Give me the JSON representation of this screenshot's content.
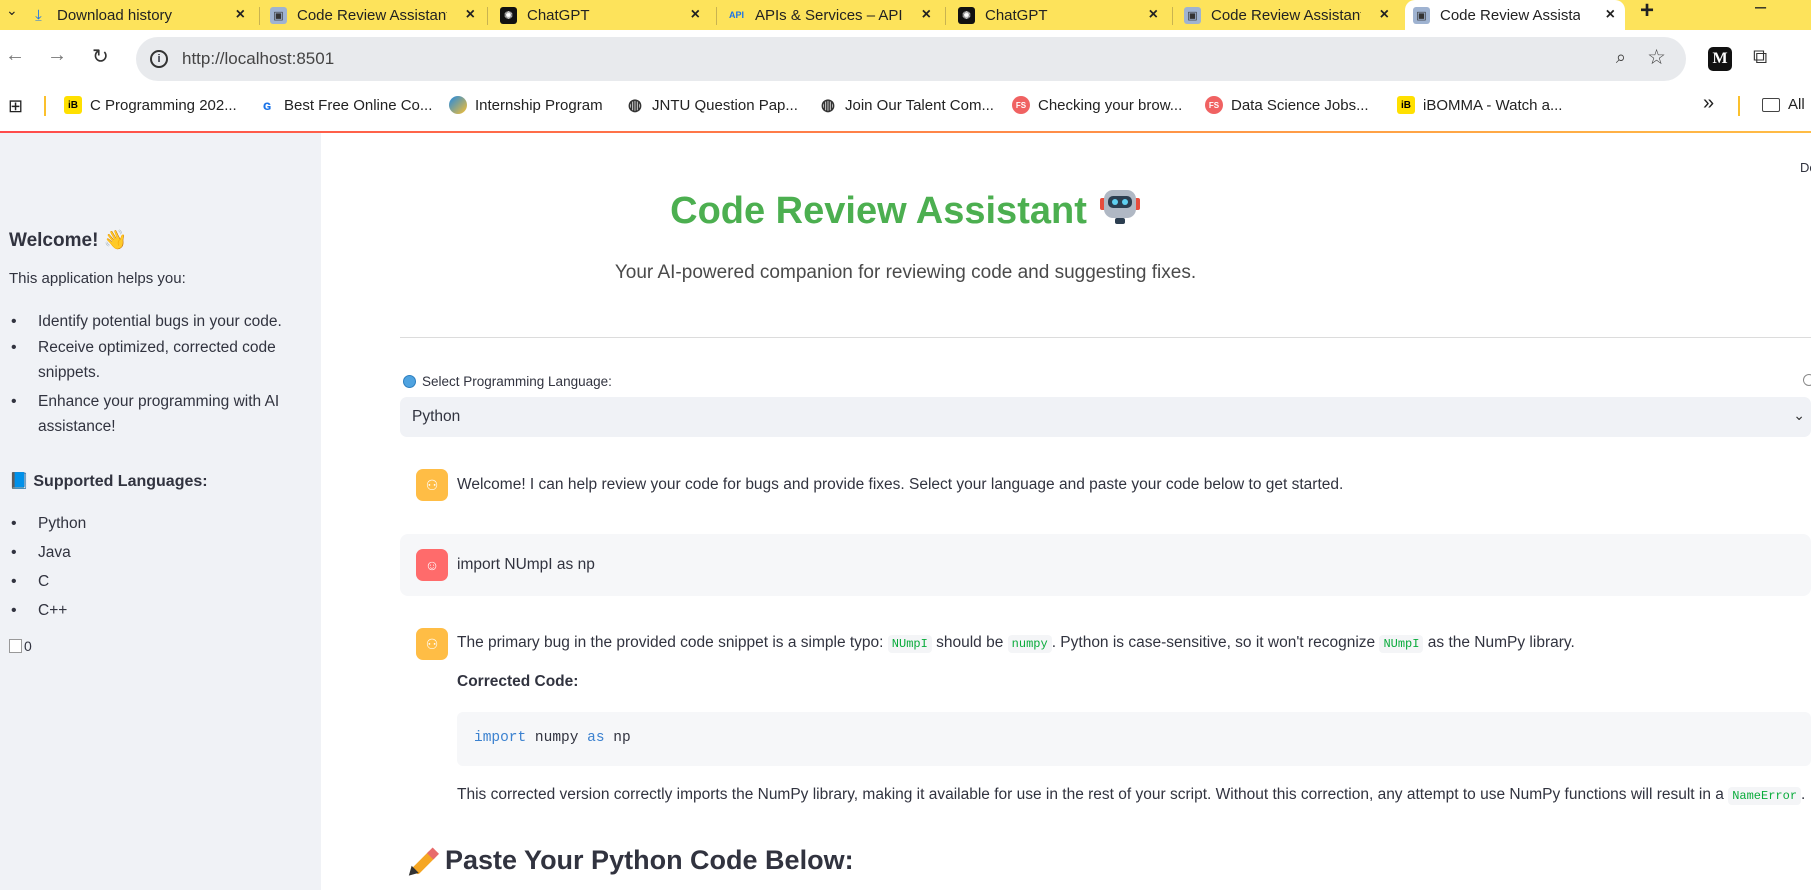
{
  "browser": {
    "tabs": [
      {
        "title": "Download history",
        "icon": "download-icon"
      },
      {
        "title": "Code Review Assistant",
        "icon": "app-icon"
      },
      {
        "title": "ChatGPT",
        "icon": "chatgpt-icon"
      },
      {
        "title": "APIs & Services – API",
        "icon": "api-icon"
      },
      {
        "title": "ChatGPT",
        "icon": "chatgpt-icon"
      },
      {
        "title": "Code Review Assistant",
        "icon": "app-icon"
      },
      {
        "title": "Code Review Assistant",
        "icon": "app-icon",
        "active": true
      }
    ],
    "url": "http://localhost:8501",
    "bookmarks": [
      {
        "label": "C Programming 202...",
        "icon": "ib-icon"
      },
      {
        "label": "Best Free Online Co...",
        "icon": "g-icon"
      },
      {
        "label": "Internship Program",
        "icon": "internship-icon"
      },
      {
        "label": "JNTU Question Pap...",
        "icon": "globe-icon"
      },
      {
        "label": "Join Our Talent Com...",
        "icon": "globe-icon"
      },
      {
        "label": "Checking your brow...",
        "icon": "fs-icon"
      },
      {
        "label": "Data Science Jobs...",
        "icon": "fs-icon"
      },
      {
        "label": "iBOMMA - Watch a...",
        "icon": "ib-icon"
      }
    ],
    "bookmarks_overflow": "»",
    "all_bookmarks": "All"
  },
  "sidebar": {
    "welcome": "Welcome! 👋",
    "intro": "This application helps you:",
    "features": [
      "Identify potential bugs in your code.",
      "Receive optimized, corrected code",
      "snippets.",
      "Enhance your programming with AI",
      "assistance!"
    ],
    "languages_heading": "📘 Supported Languages:",
    "languages": [
      "Python",
      "Java",
      "C",
      "C++"
    ],
    "image_alt": "0"
  },
  "main": {
    "deploy_label": "De",
    "title": "Code Review Assistant",
    "subtitle": "Your AI-powered companion for reviewing code and suggesting fixes.",
    "select_label": "Select Programming Language:",
    "selected_language": "Python",
    "messages": {
      "welcome": "Welcome! I can help review your code for bugs and provide fixes. Select your language and paste your code below to get started.",
      "user_code": "import NUmpI as np",
      "ai_part1": "The primary bug in the provided code snippet is a simple typo:",
      "ai_code1": "NUmpI",
      "ai_part2": "should be",
      "ai_code2": "numpy",
      "ai_part3": ". Python is case-sensitive, so it won't recognize",
      "ai_code3": "NUmpI",
      "ai_part4": "as the NumPy library.",
      "corrected_label": "Corrected Code:",
      "code_kw1": "import",
      "code_mid": " numpy ",
      "code_kw2": "as",
      "code_end": " np",
      "after_text": "This corrected version correctly imports the NumPy library, making it available for use in the rest of your script. Without this correction, any attempt to use NumPy functions will result in a",
      "after_code": "NameError",
      "after_end": "."
    },
    "paste_heading": "Paste Your Python Code Below:"
  },
  "colors": {
    "tabbar": "#fde35b",
    "title_green": "#4caf50",
    "sidebar_bg": "#f0f2f6",
    "ai_avatar": "#ffbd45",
    "user_avatar": "#ff6b6b",
    "inline_code": "#09ab3b"
  }
}
